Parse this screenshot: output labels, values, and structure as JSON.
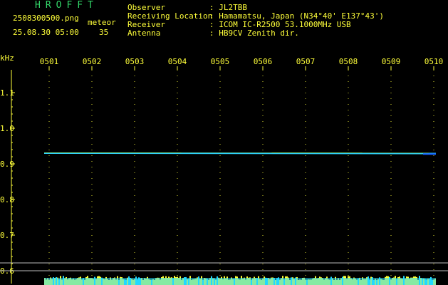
{
  "header": {
    "logo": "HROFFT",
    "filename": "2508300500.png",
    "datetime": "25.08.30 05:00",
    "meteor_label": "meteor",
    "meteor_count": "35",
    "fields": [
      {
        "label": "Observer",
        "value": ": JL2TBB"
      },
      {
        "label": "Receiving Location",
        "value": ": Hamamatsu, Japan (N34°40' E137°43')"
      },
      {
        "label": "Receiver",
        "value": ": ICOM IC-R2500 53.1000MHz USB"
      },
      {
        "label": "Antenna",
        "value": ": HB9CV Zenith dir."
      }
    ]
  },
  "chart_data": {
    "type": "heatmap",
    "ylabel": "kHz",
    "x_ticks": [
      "0501",
      "0502",
      "0503",
      "0504",
      "0505",
      "0506",
      "0507",
      "0508",
      "0509",
      "0510"
    ],
    "y_ticks": [
      "1.1",
      "1.0",
      "0.9",
      "0.8",
      "0.7",
      "0.6"
    ],
    "ylim": [
      0.6,
      1.1
    ],
    "trace": {
      "frequency_khz": 0.93,
      "color": "#2bd2ff"
    },
    "noise_band_color": "#ffff33",
    "noise_band_alt_color": "#22d8ff"
  }
}
